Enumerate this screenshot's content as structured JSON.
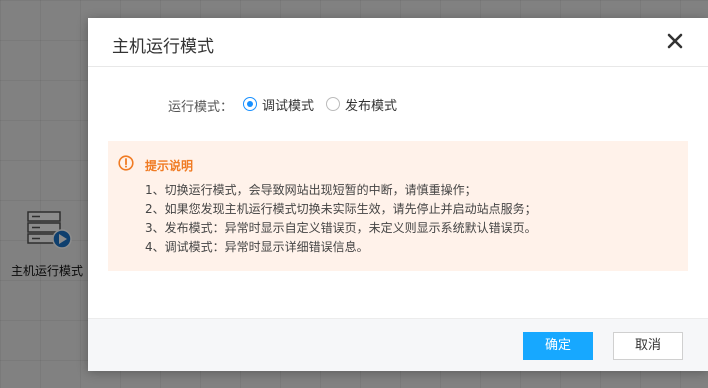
{
  "background": {
    "tile_label": "主机运行模式",
    "tile_icon": "server-play-icon"
  },
  "dialog": {
    "title": "主机运行模式",
    "close_icon": "close-icon",
    "mode": {
      "label": "运行模式：",
      "options": [
        {
          "label": "调试模式",
          "checked": true
        },
        {
          "label": "发布模式",
          "checked": false
        }
      ]
    },
    "tips": {
      "icon": "warning-circle-icon",
      "title": "提示说明",
      "items": [
        "1、切换运行模式，会导致网站出现短暂的中断，请慎重操作；",
        "2、如果您发现主机运行模式切换未实际生效，请先停止并启动站点服务；",
        "3、发布模式：异常时显示自定义错误页，未定义则显示系统默认错误页。",
        "4、调试模式：异常时显示详细错误信息。"
      ]
    },
    "buttons": {
      "ok": "确定",
      "cancel": "取消"
    }
  },
  "colors": {
    "primary": "#17a8ff",
    "radio_accent": "#1890ff",
    "tips_bg": "#fff2ea",
    "tips_title": "#f07b23"
  }
}
